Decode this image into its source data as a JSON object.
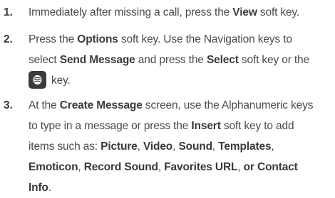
{
  "steps": [
    {
      "number": "1.",
      "lines": [
        [
          {
            "t": "Immediately after missing a call, press the ",
            "b": false
          },
          {
            "t": "View",
            "b": true
          },
          {
            "t": " soft key.",
            "b": false
          }
        ]
      ]
    },
    {
      "number": "2.",
      "lines": [
        [
          {
            "t": "Press the ",
            "b": false
          },
          {
            "t": "Options",
            "b": true
          },
          {
            "t": " soft key. Use the Navigation keys to",
            "b": false
          }
        ],
        [
          {
            "t": "select ",
            "b": false
          },
          {
            "t": "Send Message",
            "b": true
          },
          {
            "t": " and press the ",
            "b": false
          },
          {
            "t": "Select",
            "b": true
          },
          {
            "t": " soft key or the",
            "b": false
          }
        ],
        [
          {
            "icon": "ok-key-icon"
          },
          {
            "t": "key.",
            "b": false
          }
        ]
      ]
    },
    {
      "number": "3.",
      "lines": [
        [
          {
            "t": "At the ",
            "b": false
          },
          {
            "t": "Create Message",
            "b": true
          },
          {
            "t": " screen, use the Alphanumeric keys",
            "b": false
          }
        ],
        [
          {
            "t": "to type in a message or press the ",
            "b": false
          },
          {
            "t": "Insert",
            "b": true
          },
          {
            "t": " soft key to add",
            "b": false
          }
        ],
        [
          {
            "t": "items such as: ",
            "b": false
          },
          {
            "t": "Picture",
            "b": true
          },
          {
            "t": ", ",
            "b": false
          },
          {
            "t": "Video",
            "b": true
          },
          {
            "t": ", ",
            "b": false
          },
          {
            "t": "Sound",
            "b": true
          },
          {
            "t": ", ",
            "b": false
          },
          {
            "t": "Templates",
            "b": true
          },
          {
            "t": ",",
            "b": false
          }
        ],
        [
          {
            "t": "Emoticon",
            "b": true
          },
          {
            "t": ", ",
            "b": false
          },
          {
            "t": "Record Sound",
            "b": true
          },
          {
            "t": ", ",
            "b": false
          },
          {
            "t": "Favorites URL",
            "b": true
          },
          {
            "t": ", ",
            "b": false
          },
          {
            "t": "or Contact",
            "b": true
          }
        ],
        [
          {
            "t": "Info",
            "b": true
          },
          {
            "t": ".",
            "b": false
          }
        ]
      ]
    }
  ]
}
